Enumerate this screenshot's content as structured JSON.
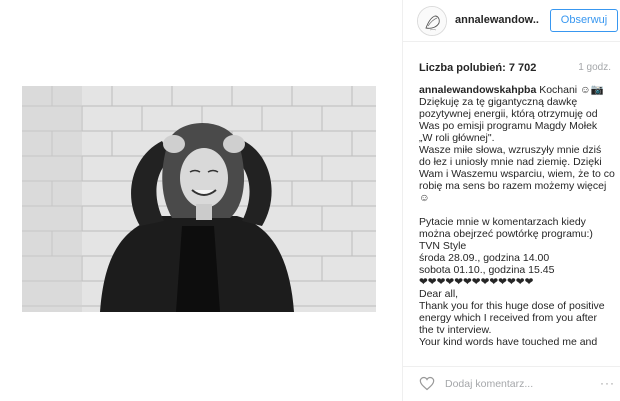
{
  "post": {
    "username": "annalewandow...",
    "follow_label": "Obserwuj"
  },
  "stats": {
    "likes_label": "Liczba polubień: 7 702",
    "time": "1 godz."
  },
  "caption": {
    "author": "annalewandowskahpba",
    "first_line_rest": " Kochani ☺📷",
    "lines": [
      "Dziękuję za tę gigantyczną dawkę",
      "pozytywnej energii, którą otrzymuję od",
      "Was po emisji programu Magdy Mołek",
      "„W roli głównej\".",
      "Wasze miłe słowa, wzruszyły mnie dziś",
      "do łez i uniosły mnie nad ziemię. Dzięki",
      "Wam i Waszemu wsparciu, wiem, że to co",
      "robię ma sens bo razem możemy więcej",
      "☺",
      "",
      "Pytacie mnie w komentarzach kiedy",
      "można obejrzeć powtórkę programu:)",
      "TVN Style",
      "środa 28.09., godzina 14.00",
      "sobota 01.10., godzina 15.45",
      "❤❤❤❤❤❤❤❤❤❤❤❤❤",
      "Dear all,",
      "Thank you for this huge dose of positive",
      "energy which I received from you after",
      "the tv interview.",
      "Your kind words have touched me and"
    ]
  },
  "footer": {
    "comment_placeholder": "Dodaj komentarz...",
    "more_label": "···"
  },
  "icons": {
    "heart": "heart-icon",
    "more": "more-options-icon"
  },
  "colors": {
    "accent": "#3897f0",
    "muted": "#a5a7aa",
    "border": "#efefef"
  }
}
